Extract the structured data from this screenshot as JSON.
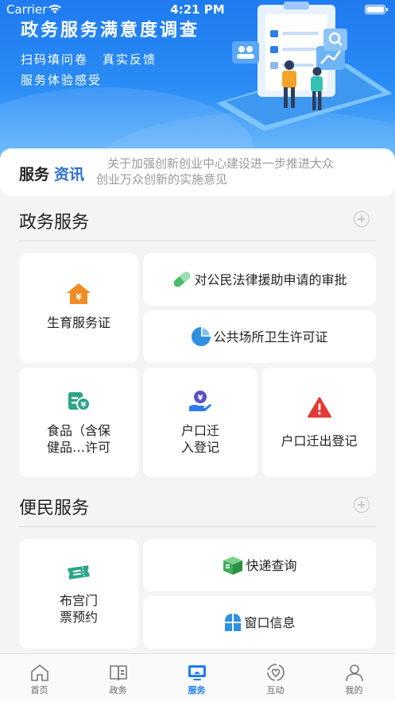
{
  "status_bar": {
    "carrier": "Carrier",
    "time": "4:21 PM"
  },
  "banner": {
    "title": "政务服务满意度调查",
    "tag1": "扫码填问卷",
    "tag2": "真实反馈",
    "tag3": "服务体验感受"
  },
  "news": {
    "brand_part1": "服务",
    "brand_part2": "资讯",
    "text_line1": "关于加强创新创业中心建设进一步推进大众",
    "text_line2": "创业万众创新的实施意见"
  },
  "gov_services": {
    "title": "政务服务",
    "items": [
      {
        "label": "生育服务证",
        "icon": "house-yen-icon"
      },
      {
        "label": "对公民法律援助申请的审批",
        "icon": "pill-icon"
      },
      {
        "label": "公共场所卫生许可证",
        "icon": "pie-chart-icon"
      },
      {
        "label_line1": "食品（含保",
        "label_line2": "健品…许可",
        "icon": "food-license-icon"
      },
      {
        "label_line1": "户口迁",
        "label_line2": "入登记",
        "icon": "hand-money-icon"
      },
      {
        "label": "户口迁出登记",
        "icon": "warning-icon"
      }
    ]
  },
  "civil_services": {
    "title": "便民服务",
    "items": [
      {
        "label_line1": "布宫门",
        "label_line2": "票预约",
        "icon": "ticket-icon"
      },
      {
        "label": "快递查询",
        "icon": "package-icon"
      },
      {
        "label": "窗口信息",
        "icon": "window-icon"
      }
    ]
  },
  "tabbar": {
    "items": [
      {
        "label": "首页",
        "icon": "home-icon"
      },
      {
        "label": "政务",
        "icon": "book-icon"
      },
      {
        "label": "服务",
        "icon": "monitor-icon",
        "active": true
      },
      {
        "label": "互动",
        "icon": "heart-hands-icon"
      },
      {
        "label": "我的",
        "icon": "user-icon"
      }
    ]
  },
  "colors": {
    "brand_blue": "#1f7bf0",
    "accent_orange": "#f08c23",
    "accent_green": "#2aa58a",
    "alert_red": "#e53935"
  }
}
